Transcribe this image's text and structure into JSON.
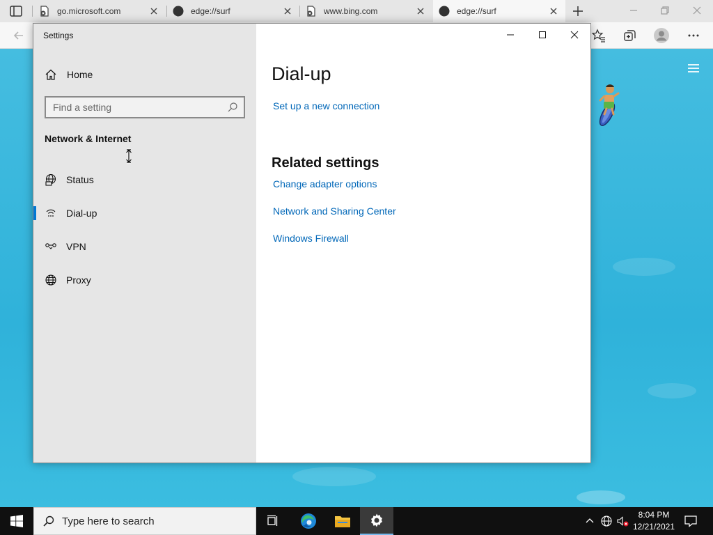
{
  "browser": {
    "tabs": [
      {
        "title": "go.microsoft.com",
        "active": false
      },
      {
        "title": "edge://surf",
        "active": false
      },
      {
        "title": "www.bing.com",
        "active": false
      },
      {
        "title": "edge://surf",
        "active": true
      }
    ]
  },
  "settings": {
    "app_title": "Settings",
    "home_label": "Home",
    "search_placeholder": "Find a setting",
    "section_title": "Network & Internet",
    "nav_items": [
      {
        "label": "Status",
        "icon": "globe-status-icon",
        "selected": false
      },
      {
        "label": "Dial-up",
        "icon": "dialup-icon",
        "selected": true
      },
      {
        "label": "VPN",
        "icon": "vpn-icon",
        "selected": false
      },
      {
        "label": "Proxy",
        "icon": "globe-icon",
        "selected": false
      }
    ],
    "page_title": "Dial-up",
    "setup_link": "Set up a new connection",
    "related_title": "Related settings",
    "related_links": [
      "Change adapter options",
      "Network and Sharing Center",
      "Windows Firewall"
    ]
  },
  "taskbar": {
    "search_placeholder": "Type here to search",
    "time": "8:04 PM",
    "date": "12/21/2021"
  },
  "colors": {
    "accent": "#0078d4",
    "link": "#0067b8",
    "nav_bg": "#e6e6e6",
    "water": "#3bb5d8"
  }
}
